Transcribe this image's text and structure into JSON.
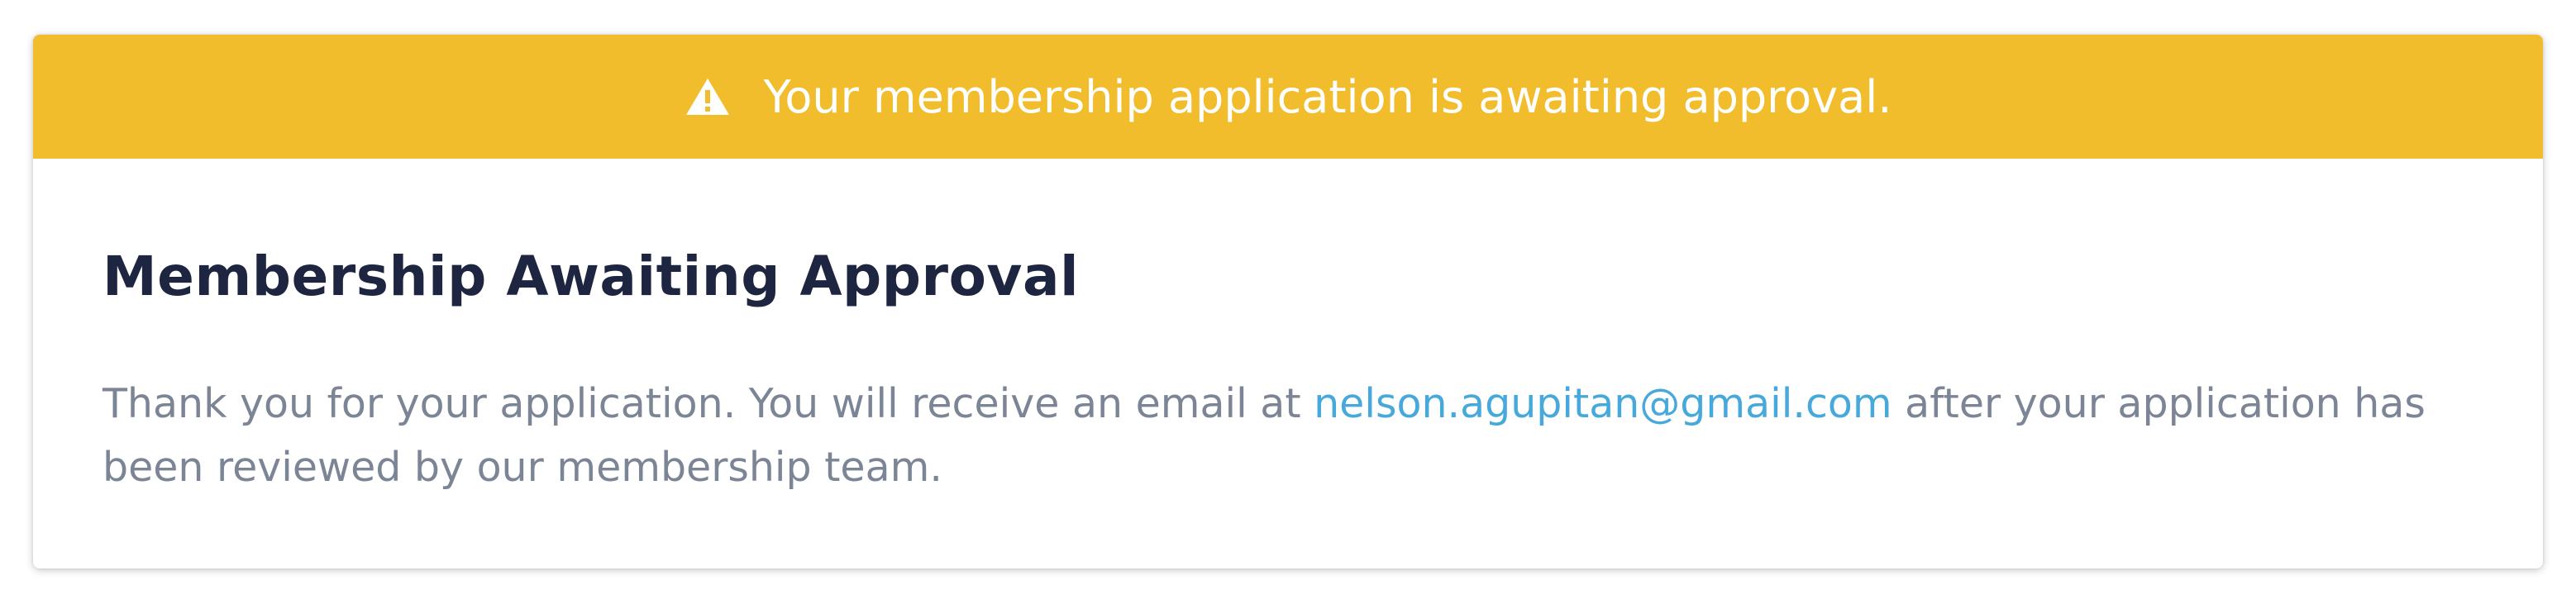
{
  "banner": {
    "icon": "warning-icon",
    "text": "Your membership application is awaiting approval.",
    "color": "#f2bd2c"
  },
  "panel": {
    "title": "Membership Awaiting Approval",
    "message_before": "Thank you for your application. You will receive an email at ",
    "email": "nelson.agupitan@gmail.com",
    "message_after": " after your application has been reviewed by our membership team."
  },
  "colors": {
    "title": "#1e2540",
    "body_text": "#7b8596",
    "link": "#47a9db"
  }
}
